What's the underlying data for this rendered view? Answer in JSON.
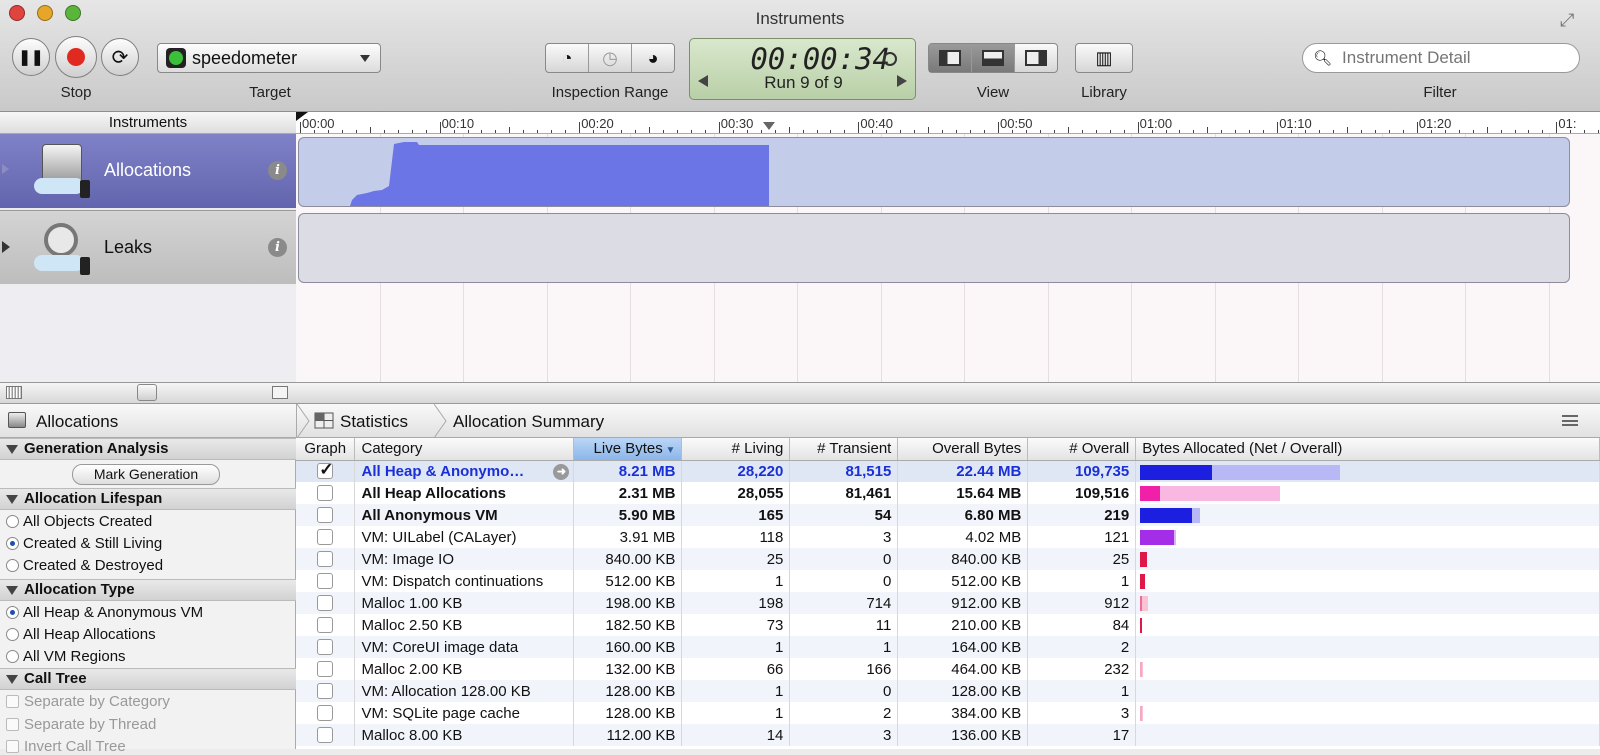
{
  "window": {
    "title": "Instruments"
  },
  "toolbar": {
    "stop_label": "Stop",
    "target_label": "Target",
    "target_name": "speedometer",
    "inspection_label": "Inspection Range",
    "time": "00:00:34",
    "run": "Run 9 of 9",
    "view_label": "View",
    "library_label": "Library",
    "filter_label": "Filter",
    "search_placeholder": "Instrument Detail"
  },
  "timeline": {
    "header": "Instruments",
    "ticks": [
      "00:00",
      "00:10",
      "00:20",
      "00:30",
      "00:40",
      "00:50",
      "01:00",
      "01:10",
      "01:20",
      "01:"
    ]
  },
  "instruments": [
    {
      "name": "Allocations",
      "selected": true
    },
    {
      "name": "Leaks",
      "selected": false
    }
  ],
  "pathbar": {
    "instrument": "Allocations",
    "view": "Statistics",
    "detail": "Allocation Summary"
  },
  "sidebar": {
    "gen_title": "Generation Analysis",
    "mark_button": "Mark Generation",
    "lifespan_title": "Allocation Lifespan",
    "lifespan": [
      "All Objects Created",
      "Created & Still Living",
      "Created & Destroyed"
    ],
    "type_title": "Allocation Type",
    "types": [
      "All Heap & Anonymous VM",
      "All Heap Allocations",
      "All VM Regions"
    ],
    "calltree_title": "Call Tree",
    "calltree": [
      "Separate by Category",
      "Separate by Thread",
      "Invert Call Tree"
    ]
  },
  "table": {
    "headers": [
      "Graph",
      "Category",
      "Live Bytes",
      "# Living",
      "# Transient",
      "Overall Bytes",
      "# Overall",
      "Bytes Allocated (Net / Overall)"
    ],
    "rows": [
      {
        "checked": true,
        "category": "All Heap & Anonymo…",
        "live": "8.21 MB",
        "living": "28,220",
        "transient": "81,515",
        "overall_bytes": "22.44 MB",
        "overall": "109,735",
        "net_frac": 0.36,
        "overall_frac": 1.0,
        "net_color": "#1c1fe0",
        "overall_color": "#b7b8f5"
      },
      {
        "checked": false,
        "category": "All Heap Allocations",
        "live": "2.31 MB",
        "living": "28,055",
        "transient": "81,461",
        "overall_bytes": "15.64 MB",
        "overall": "109,516",
        "net_frac": 0.1,
        "overall_frac": 0.7,
        "net_color": "#f020a8",
        "overall_color": "#f8b8e2"
      },
      {
        "checked": false,
        "category": "All Anonymous VM",
        "live": "5.90 MB",
        "living": "165",
        "transient": "54",
        "overall_bytes": "6.80 MB",
        "overall": "219",
        "net_frac": 0.26,
        "overall_frac": 0.3,
        "net_color": "#1c1fe0",
        "overall_color": "#b7b8f5"
      },
      {
        "checked": false,
        "category": "VM: UILabel (CALayer)",
        "live": "3.91 MB",
        "living": "118",
        "transient": "3",
        "overall_bytes": "4.02 MB",
        "overall": "121",
        "net_frac": 0.17,
        "overall_frac": 0.18,
        "net_color": "#a42ee8",
        "overall_color": "#d9b3f3"
      },
      {
        "checked": false,
        "category": "VM: Image IO",
        "live": "840.00 KB",
        "living": "25",
        "transient": "0",
        "overall_bytes": "840.00 KB",
        "overall": "25",
        "net_frac": 0.036,
        "overall_frac": 0.036,
        "net_color": "#e0184a",
        "overall_color": "#f5a8bc"
      },
      {
        "checked": false,
        "category": "VM: Dispatch continuations",
        "live": "512.00 KB",
        "living": "1",
        "transient": "0",
        "overall_bytes": "512.00 KB",
        "overall": "1",
        "net_frac": 0.022,
        "overall_frac": 0.022,
        "net_color": "#e0184a",
        "overall_color": "#f5a8bc"
      },
      {
        "checked": false,
        "category": "Malloc 1.00 KB",
        "live": "198.00 KB",
        "living": "198",
        "transient": "714",
        "overall_bytes": "912.00 KB",
        "overall": "912",
        "net_frac": 0.009,
        "overall_frac": 0.039,
        "net_color": "#f06a9a",
        "overall_color": "#f8c4d4"
      },
      {
        "checked": false,
        "category": "Malloc 2.50 KB",
        "live": "182.50 KB",
        "living": "73",
        "transient": "11",
        "overall_bytes": "210.00 KB",
        "overall": "84",
        "net_frac": 0.008,
        "overall_frac": 0.009,
        "net_color": "#e0184a",
        "overall_color": "#f5a8bc"
      },
      {
        "checked": false,
        "category": "VM: CoreUI image data",
        "live": "160.00 KB",
        "living": "1",
        "transient": "1",
        "overall_bytes": "164.00 KB",
        "overall": "2",
        "net_frac": 0.0,
        "overall_frac": 0.0,
        "net_color": "#e0184a",
        "overall_color": "#f5a8bc"
      },
      {
        "checked": false,
        "category": "Malloc 2.00 KB",
        "live": "132.00 KB",
        "living": "66",
        "transient": "166",
        "overall_bytes": "464.00 KB",
        "overall": "232",
        "net_frac": 0.004,
        "overall_frac": 0.012,
        "net_color": "#f7a8c4",
        "overall_color": "#f8c4d4"
      },
      {
        "checked": false,
        "category": "VM: Allocation 128.00 KB",
        "live": "128.00 KB",
        "living": "1",
        "transient": "0",
        "overall_bytes": "128.00 KB",
        "overall": "1",
        "net_frac": 0.0,
        "overall_frac": 0.0,
        "net_color": "#e0184a",
        "overall_color": "#f5a8bc"
      },
      {
        "checked": false,
        "category": "VM: SQLite page cache",
        "live": "128.00 KB",
        "living": "1",
        "transient": "2",
        "overall_bytes": "384.00 KB",
        "overall": "3",
        "net_frac": 0.004,
        "overall_frac": 0.012,
        "net_color": "#f7a8c4",
        "overall_color": "#f8c4d4"
      },
      {
        "checked": false,
        "category": "Malloc 8.00 KB",
        "live": "112.00 KB",
        "living": "14",
        "transient": "3",
        "overall_bytes": "136.00 KB",
        "overall": "17",
        "net_frac": 0.0,
        "overall_frac": 0.0,
        "net_color": "#e0184a",
        "overall_color": "#f5a8bc"
      }
    ]
  }
}
